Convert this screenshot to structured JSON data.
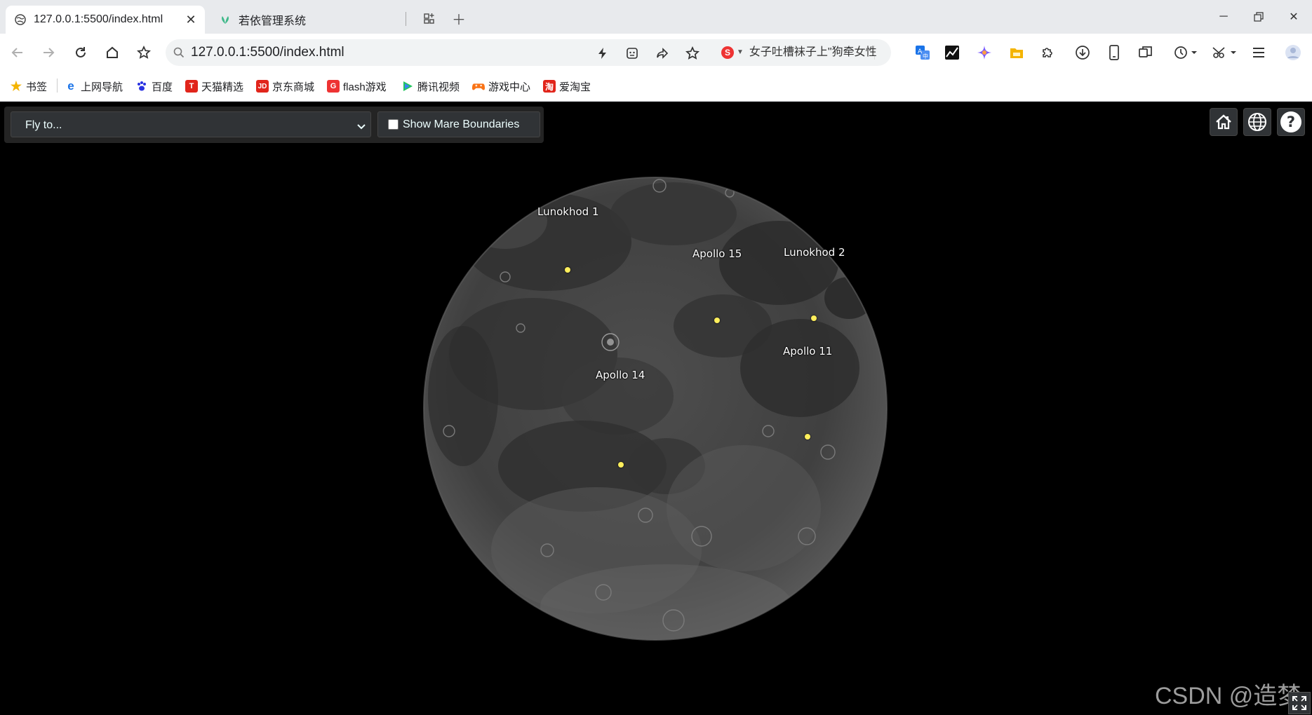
{
  "browser": {
    "tabs": [
      {
        "title": "127.0.0.1:5500/index.html",
        "active": true
      },
      {
        "title": "若依管理系统",
        "active": false
      }
    ],
    "url": "127.0.0.1:5500/index.html",
    "news_ticker": "女子吐槽袜子上\"狗牵女性"
  },
  "bookmarks": [
    {
      "label": "书签",
      "icon": "star-icon",
      "color": "#f4b400"
    },
    {
      "label": "上网导航",
      "icon": "ie-icon",
      "color": "#1a73e8"
    },
    {
      "label": "百度",
      "icon": "baidu-paw-icon",
      "color": "#2932e1"
    },
    {
      "label": "天猫精选",
      "icon": "tmall-icon",
      "color": "#e1251b"
    },
    {
      "label": "京东商城",
      "icon": "jd-icon",
      "color": "#e1251b"
    },
    {
      "label": "flash游戏",
      "icon": "flash-game-icon",
      "color": "#e33"
    },
    {
      "label": "腾讯视频",
      "icon": "tencent-video-icon",
      "color": "#22c55e"
    },
    {
      "label": "游戏中心",
      "icon": "game-center-icon",
      "color": "#f97316"
    },
    {
      "label": "爱淘宝",
      "icon": "taobao-icon",
      "color": "#e1251b"
    }
  ],
  "cesium": {
    "flyto_placeholder": "Fly to...",
    "mare_label": "Show Mare Boundaries",
    "mare_checked": false,
    "landing_sites": [
      {
        "name": "Lunokhod 1"
      },
      {
        "name": "Apollo 15"
      },
      {
        "name": "Lunokhod 2"
      },
      {
        "name": "Apollo 11"
      },
      {
        "name": "Apollo 14"
      }
    ],
    "marker_color": "#ffef5c"
  },
  "watermark": "CSDN @造梦"
}
